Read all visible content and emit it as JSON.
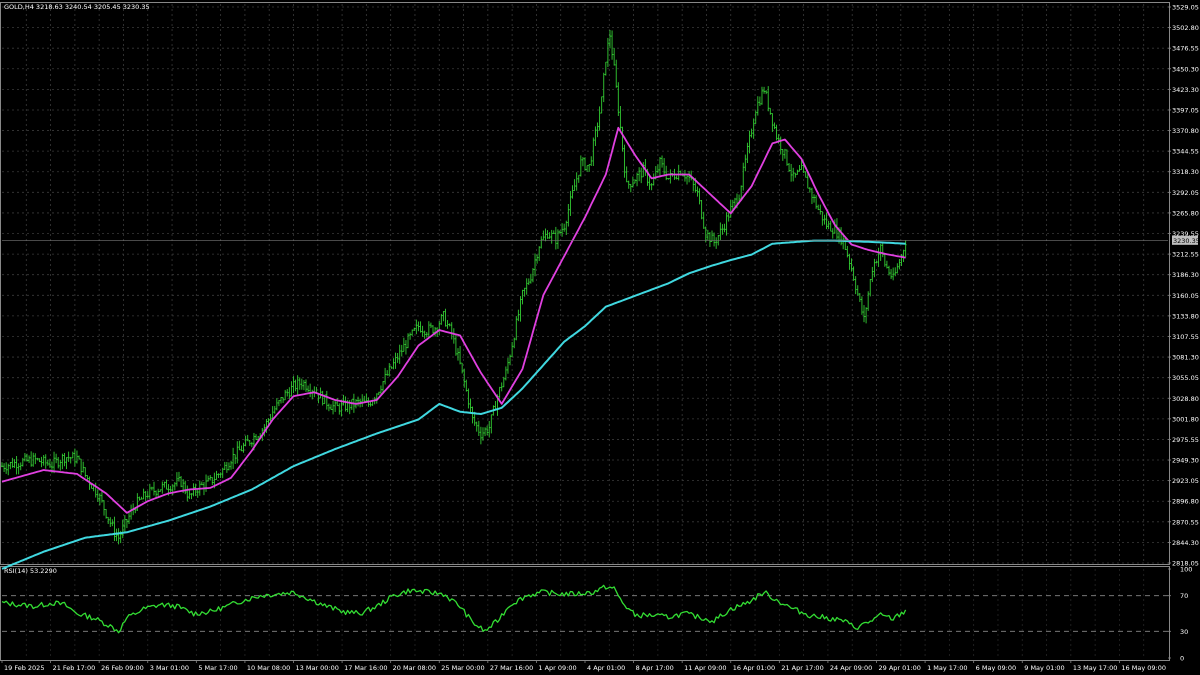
{
  "header": {
    "symbol_line": "GOLD,H4  3218.63 3240.54 3205.45 3230.35"
  },
  "rsi_header": "RSI(14) 53.2290",
  "colors": {
    "background": "#000000",
    "grid": "#3a3a3a",
    "candles": "#33cc33",
    "ma_fast": "#e040e0",
    "ma_slow": "#40d8e0",
    "rsi": "#33dd33",
    "price_tag_bg": "#c0c0c0"
  },
  "chart_data": [
    {
      "type": "line",
      "title": "GOLD,H4",
      "subtitle": "3218.63 3240.54 3205.45 3230.35",
      "ylim": [
        2818.05,
        3529.05
      ],
      "grid": true,
      "current_price": "3230.35",
      "y_ticks": [
        "3529.05",
        "3502.80",
        "3476.55",
        "3450.30",
        "3423.30",
        "3397.05",
        "3370.80",
        "3344.55",
        "3318.30",
        "3292.05",
        "3265.80",
        "3239.55",
        "3212.55",
        "3186.30",
        "3160.05",
        "3133.80",
        "3107.55",
        "3081.30",
        "3055.05",
        "3028.80",
        "3001.80",
        "2975.55",
        "2949.30",
        "2923.05",
        "2896.80",
        "2870.55",
        "2844.30",
        "2818.05"
      ],
      "x_ticks": [
        "19 Feb 2025",
        "21 Feb 17:00",
        "26 Feb 09:00",
        "3 Mar 01:00",
        "5 Mar 17:00",
        "10 Mar 08:00",
        "13 Mar 00:00",
        "17 Mar 16:00",
        "20 Mar 08:00",
        "25 Mar 00:00",
        "27 Mar 16:00",
        "1 Apr 09:00",
        "4 Apr 01:00",
        "8 Apr 17:00",
        "11 Apr 09:00",
        "16 Apr 01:00",
        "21 Apr 17:00",
        "24 Apr 09:00",
        "29 Apr 01:00",
        "1 May 17:00",
        "6 May 09:00",
        "9 May 01:00",
        "13 May 17:00",
        "16 May 09:00"
      ],
      "series": [
        {
          "kind": "candles",
          "close": [
            [
              0,
              2940
            ],
            [
              4,
              2945
            ],
            [
              8,
              2948
            ],
            [
              12,
              2942
            ],
            [
              15,
              2952
            ],
            [
              18,
              2950
            ],
            [
              20,
              2928
            ],
            [
              23,
              2905
            ],
            [
              25,
              2880
            ],
            [
              27,
              2855
            ],
            [
              28,
              2848
            ],
            [
              30,
              2870
            ],
            [
              32,
              2890
            ],
            [
              35,
              2905
            ],
            [
              38,
              2912
            ],
            [
              40,
              2915
            ],
            [
              43,
              2920
            ],
            [
              45,
              2900
            ],
            [
              47,
              2912
            ],
            [
              50,
              2920
            ],
            [
              53,
              2935
            ],
            [
              55,
              2950
            ],
            [
              58,
              2965
            ],
            [
              60,
              2975
            ],
            [
              63,
              2990
            ],
            [
              65,
              3010
            ],
            [
              68,
              3032
            ],
            [
              70,
              3042
            ],
            [
              72,
              3048
            ],
            [
              75,
              3038
            ],
            [
              78,
              3022
            ],
            [
              80,
              3015
            ],
            [
              83,
              3018
            ],
            [
              86,
              3022
            ],
            [
              88,
              3020
            ],
            [
              90,
              3035
            ],
            [
              93,
              3062
            ],
            [
              95,
              3080
            ],
            [
              97,
              3098
            ],
            [
              100,
              3120
            ],
            [
              102,
              3115
            ],
            [
              104,
              3118
            ],
            [
              106,
              3132
            ],
            [
              108,
              3110
            ],
            [
              110,
              3070
            ],
            [
              112,
              3025
            ],
            [
              113,
              3000
            ],
            [
              115,
              2982
            ],
            [
              117,
              2990
            ],
            [
              119,
              3030
            ],
            [
              121,
              3060
            ],
            [
              123,
              3110
            ],
            [
              125,
              3160
            ],
            [
              127,
              3185
            ],
            [
              129,
              3225
            ],
            [
              131,
              3240
            ],
            [
              133,
              3232
            ],
            [
              135,
              3250
            ],
            [
              137,
              3290
            ],
            [
              139,
              3330
            ],
            [
              141,
              3325
            ],
            [
              143,
              3380
            ],
            [
              144,
              3410
            ],
            [
              145,
              3465
            ],
            [
              146,
              3495
            ],
            [
              147,
              3450
            ],
            [
              148,
              3400
            ],
            [
              150,
              3300
            ],
            [
              152,
              3310
            ],
            [
              154,
              3320
            ],
            [
              156,
              3300
            ],
            [
              158,
              3330
            ],
            [
              160,
              3310
            ],
            [
              163,
              3320
            ],
            [
              165,
              3310
            ],
            [
              167,
              3290
            ],
            [
              169,
              3240
            ],
            [
              171,
              3228
            ],
            [
              173,
              3245
            ],
            [
              175,
              3270
            ],
            [
              177,
              3290
            ],
            [
              179,
              3345
            ],
            [
              181,
              3400
            ],
            [
              183,
              3425
            ],
            [
              184,
              3405
            ],
            [
              186,
              3365
            ],
            [
              188,
              3340
            ],
            [
              190,
              3310
            ],
            [
              192,
              3320
            ],
            [
              194,
              3295
            ],
            [
              196,
              3270
            ],
            [
              198,
              3250
            ],
            [
              200,
              3245
            ],
            [
              202,
              3230
            ],
            [
              204,
              3195
            ],
            [
              206,
              3150
            ],
            [
              207,
              3128
            ],
            [
              209,
              3195
            ],
            [
              211,
              3220
            ],
            [
              212,
              3200
            ],
            [
              214,
              3180
            ],
            [
              216,
              3210
            ],
            [
              217,
              3230
            ]
          ]
        },
        {
          "name": "",
          "kind": "ma_fast",
          "values": [
            [
              0,
              2920
            ],
            [
              10,
              2935
            ],
            [
              18,
              2930
            ],
            [
              25,
              2905
            ],
            [
              30,
              2880
            ],
            [
              35,
              2895
            ],
            [
              40,
              2905
            ],
            [
              45,
              2910
            ],
            [
              50,
              2912
            ],
            [
              55,
              2925
            ],
            [
              60,
              2960
            ],
            [
              65,
              3000
            ],
            [
              70,
              3030
            ],
            [
              75,
              3035
            ],
            [
              80,
              3025
            ],
            [
              85,
              3020
            ],
            [
              90,
              3025
            ],
            [
              95,
              3055
            ],
            [
              100,
              3095
            ],
            [
              105,
              3115
            ],
            [
              110,
              3108
            ],
            [
              115,
              3060
            ],
            [
              120,
              3020
            ],
            [
              125,
              3065
            ],
            [
              130,
              3160
            ],
            [
              135,
              3210
            ],
            [
              140,
              3260
            ],
            [
              145,
              3315
            ],
            [
              148,
              3375
            ],
            [
              152,
              3340
            ],
            [
              156,
              3310
            ],
            [
              160,
              3315
            ],
            [
              165,
              3315
            ],
            [
              170,
              3290
            ],
            [
              175,
              3265
            ],
            [
              180,
              3300
            ],
            [
              185,
              3355
            ],
            [
              188,
              3360
            ],
            [
              192,
              3335
            ],
            [
              196,
              3290
            ],
            [
              200,
              3250
            ],
            [
              204,
              3225
            ],
            [
              208,
              3218
            ],
            [
              212,
              3213
            ],
            [
              217,
              3208
            ]
          ]
        },
        {
          "name": "",
          "kind": "ma_slow",
          "values": [
            [
              0,
              2808
            ],
            [
              10,
              2830
            ],
            [
              20,
              2848
            ],
            [
              30,
              2855
            ],
            [
              40,
              2870
            ],
            [
              50,
              2888
            ],
            [
              60,
              2910
            ],
            [
              70,
              2940
            ],
            [
              80,
              2962
            ],
            [
              90,
              2982
            ],
            [
              100,
              3000
            ],
            [
              105,
              3020
            ],
            [
              110,
              3010
            ],
            [
              115,
              3007
            ],
            [
              120,
              3015
            ],
            [
              125,
              3040
            ],
            [
              130,
              3070
            ],
            [
              135,
              3100
            ],
            [
              140,
              3120
            ],
            [
              145,
              3145
            ],
            [
              150,
              3155
            ],
            [
              155,
              3165
            ],
            [
              160,
              3175
            ],
            [
              165,
              3188
            ],
            [
              170,
              3197
            ],
            [
              175,
              3205
            ],
            [
              180,
              3212
            ],
            [
              185,
              3226
            ],
            [
              190,
              3228
            ],
            [
              195,
              3230
            ],
            [
              200,
              3230
            ],
            [
              205,
              3229
            ],
            [
              210,
              3228
            ],
            [
              217,
              3226
            ]
          ]
        }
      ]
    },
    {
      "type": "line",
      "title": "RSI(14) 53.2290",
      "ylim": [
        0,
        100
      ],
      "y_ticks": [
        "100",
        "70",
        "30",
        "0"
      ],
      "levels": [
        70,
        30
      ],
      "series": [
        {
          "name": "",
          "values": [
            [
              0,
              62
            ],
            [
              4,
              60
            ],
            [
              8,
              58
            ],
            [
              12,
              62
            ],
            [
              15,
              60
            ],
            [
              18,
              50
            ],
            [
              22,
              45
            ],
            [
              26,
              36
            ],
            [
              28,
              30
            ],
            [
              30,
              45
            ],
            [
              34,
              55
            ],
            [
              38,
              60
            ],
            [
              42,
              58
            ],
            [
              46,
              50
            ],
            [
              50,
              52
            ],
            [
              54,
              58
            ],
            [
              58,
              65
            ],
            [
              62,
              70
            ],
            [
              66,
              72
            ],
            [
              70,
              74
            ],
            [
              74,
              66
            ],
            [
              78,
              58
            ],
            [
              82,
              52
            ],
            [
              86,
              50
            ],
            [
              90,
              58
            ],
            [
              94,
              70
            ],
            [
              98,
              76
            ],
            [
              102,
              74
            ],
            [
              106,
              72
            ],
            [
              110,
              58
            ],
            [
              113,
              40
            ],
            [
              116,
              30
            ],
            [
              119,
              42
            ],
            [
              122,
              60
            ],
            [
              126,
              70
            ],
            [
              130,
              74
            ],
            [
              134,
              72
            ],
            [
              138,
              72
            ],
            [
              142,
              74
            ],
            [
              145,
              80
            ],
            [
              147,
              78
            ],
            [
              149,
              62
            ],
            [
              152,
              48
            ],
            [
              156,
              48
            ],
            [
              160,
              46
            ],
            [
              164,
              50
            ],
            [
              168,
              45
            ],
            [
              171,
              42
            ],
            [
              175,
              55
            ],
            [
              179,
              62
            ],
            [
              183,
              74
            ],
            [
              186,
              65
            ],
            [
              190,
              55
            ],
            [
              194,
              48
            ],
            [
              198,
              45
            ],
            [
              202,
              42
            ],
            [
              205,
              34
            ],
            [
              208,
              40
            ],
            [
              211,
              48
            ],
            [
              214,
              44
            ],
            [
              217,
              53
            ]
          ]
        }
      ]
    }
  ]
}
